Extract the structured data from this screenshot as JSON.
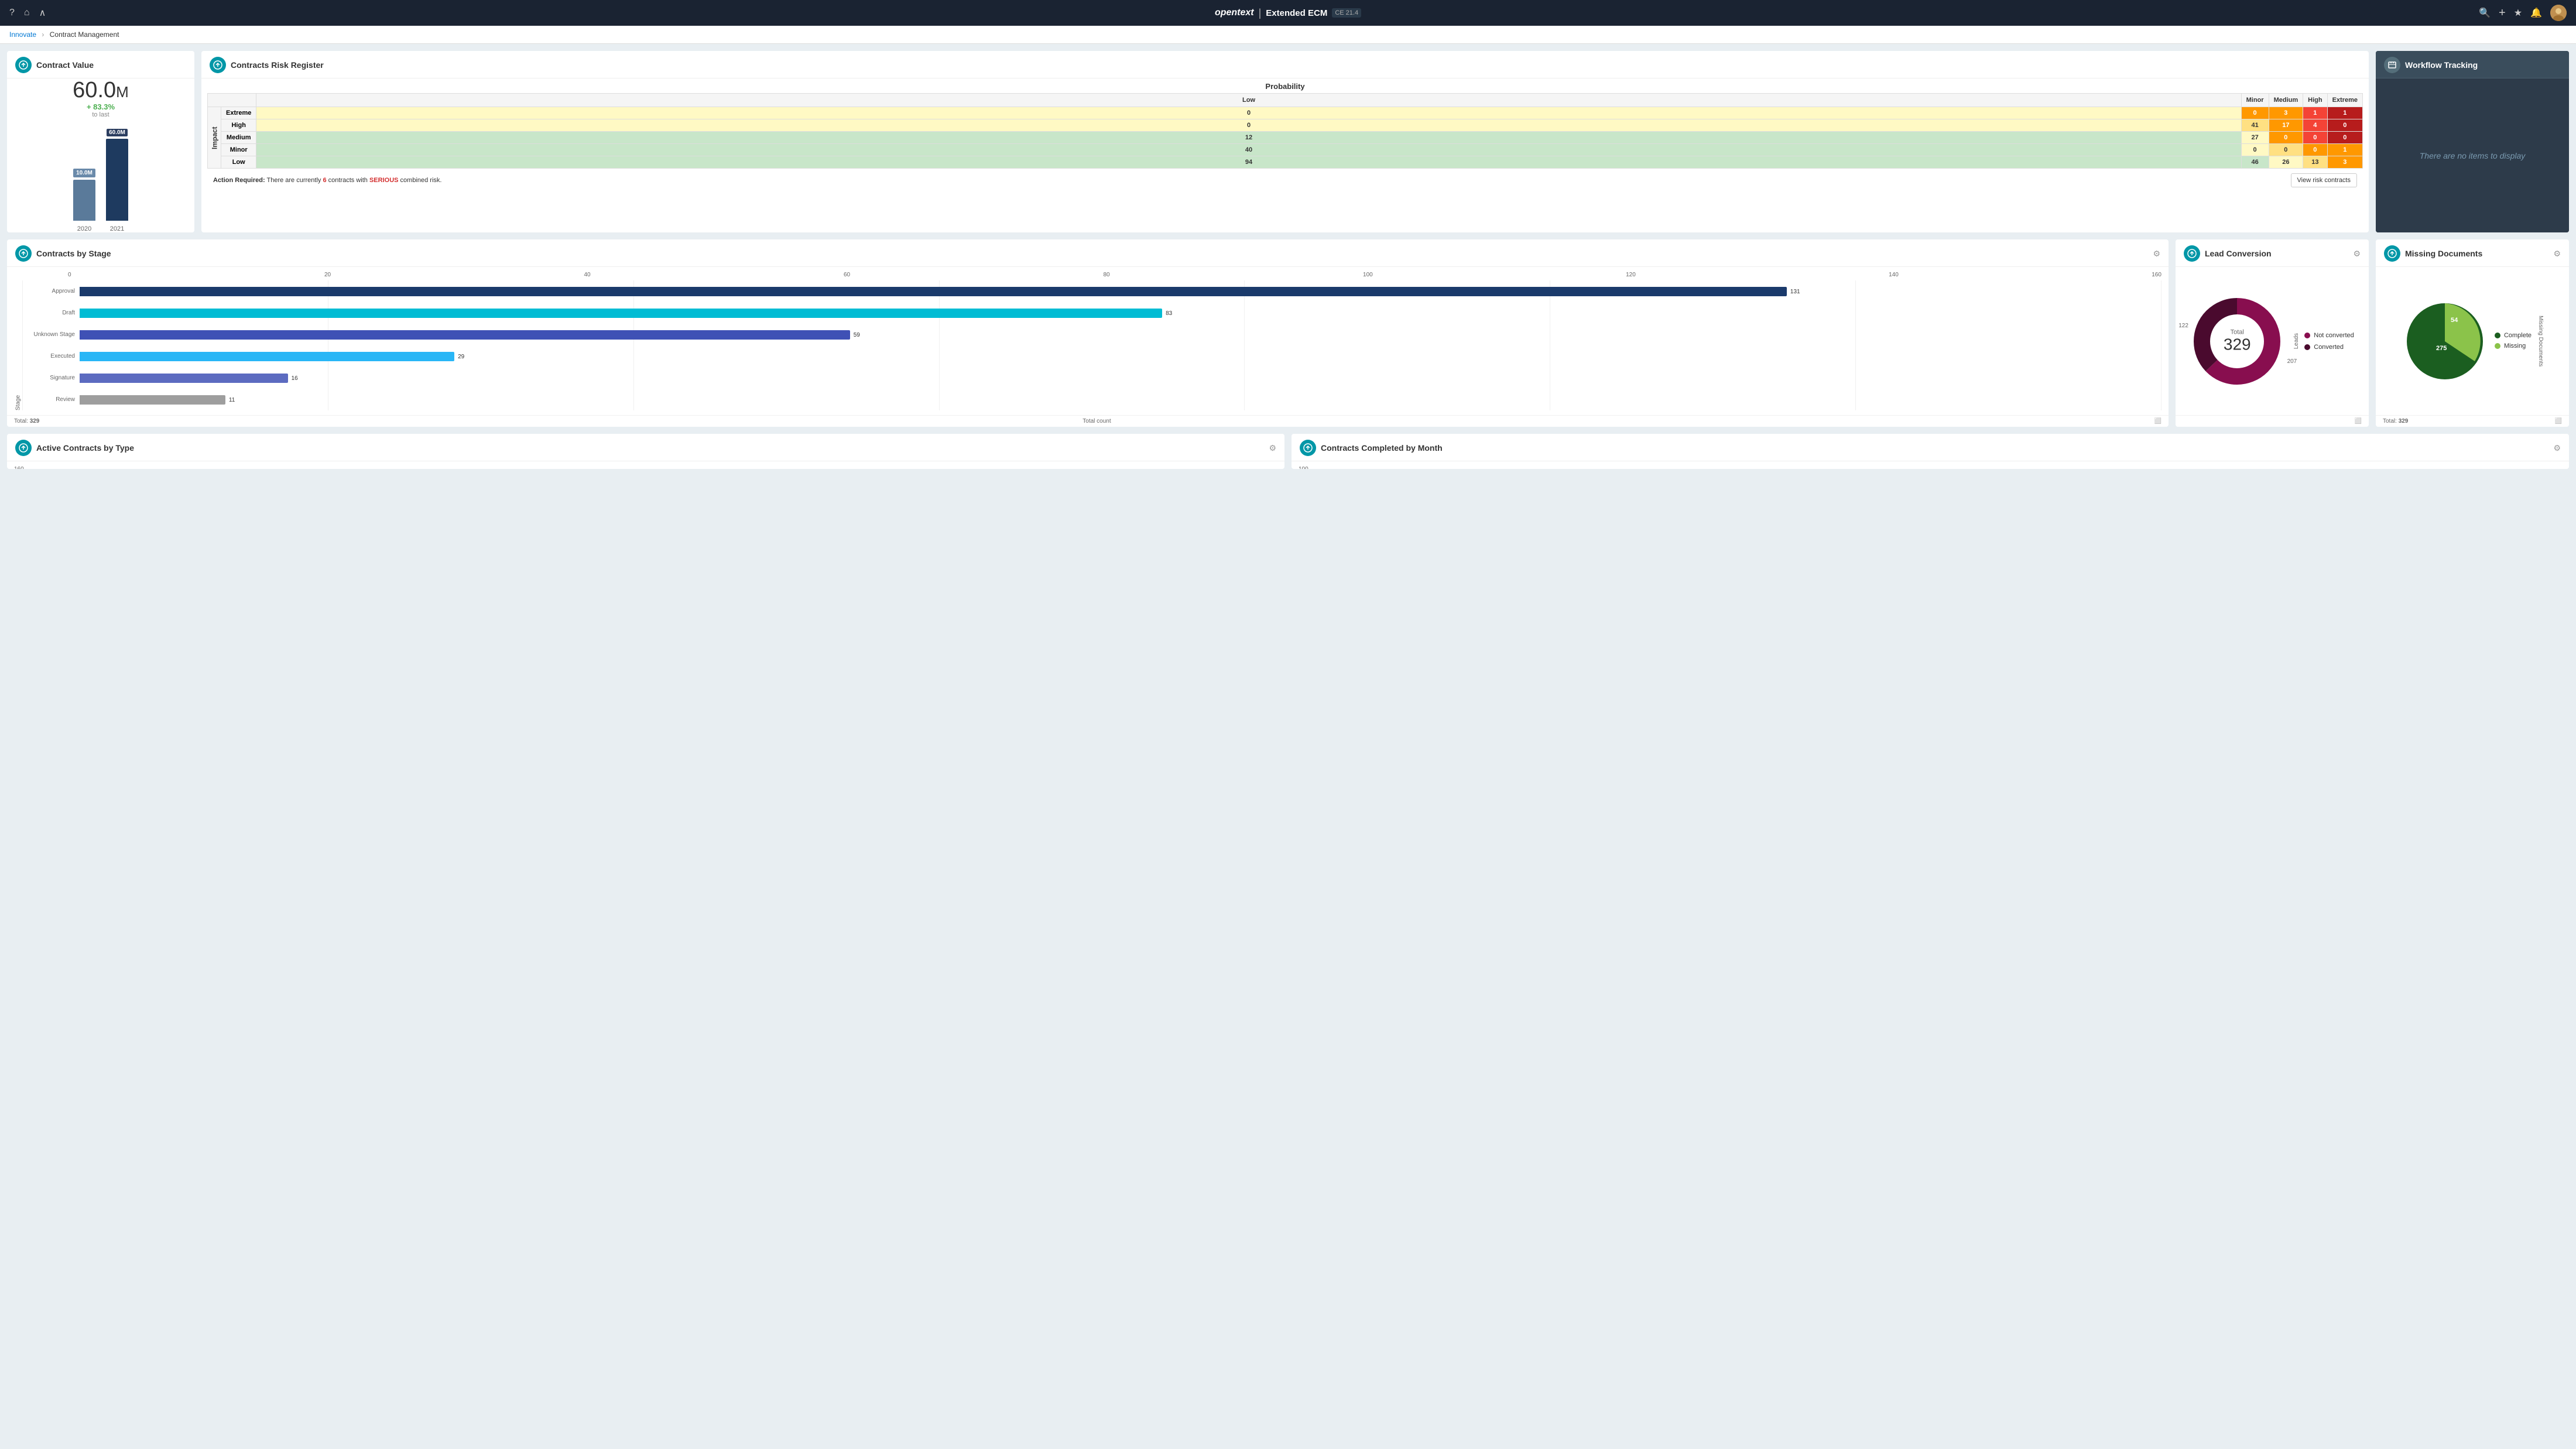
{
  "app": {
    "brand": "opentext",
    "product": "Extended ECM",
    "version": "CE 21.4"
  },
  "nav": {
    "icons": [
      "question-mark",
      "home",
      "chevron-up"
    ],
    "right_icons": [
      "search",
      "plus",
      "star",
      "bell"
    ],
    "breadcrumb_parent": "Innovate",
    "breadcrumb_current": "Contract Management"
  },
  "contract_value": {
    "title": "Contract Value",
    "current_value": "60.0",
    "unit": "M",
    "change_pct": "+ 83.3%",
    "change_label": "to last",
    "bar_2020_label": "10.0M",
    "bar_2020_year": "2020",
    "bar_2021_label": "60.0M",
    "bar_2021_year": "2021"
  },
  "risk_register": {
    "title": "Contracts Risk Register",
    "probability_label": "Probability",
    "impact_label": "Impact",
    "columns": [
      "Low",
      "Minor",
      "Medium",
      "High",
      "Extreme"
    ],
    "rows": [
      {
        "label": "Extreme",
        "values": [
          0,
          0,
          3,
          1,
          1
        ],
        "colors": [
          "yellow",
          "orange",
          "orange",
          "red",
          "dark-red"
        ]
      },
      {
        "label": "High",
        "values": [
          0,
          41,
          17,
          4,
          0
        ],
        "colors": [
          "yellow",
          "light-orange",
          "orange",
          "red",
          "dark-red"
        ]
      },
      {
        "label": "Medium",
        "values": [
          12,
          27,
          0,
          0,
          0
        ],
        "colors": [
          "green",
          "yellow",
          "orange",
          "red",
          "dark-red"
        ]
      },
      {
        "label": "Minor",
        "values": [
          40,
          0,
          0,
          0,
          1
        ],
        "colors": [
          "green",
          "yellow",
          "light-orange",
          "orange",
          "orange"
        ]
      },
      {
        "label": "Low",
        "values": [
          94,
          46,
          26,
          13,
          3
        ],
        "colors": [
          "green",
          "green",
          "yellow",
          "light-orange",
          "orange"
        ]
      }
    ],
    "action_text": "Action Required: There are currently",
    "action_count": "6",
    "action_mid": "contracts with",
    "action_serious": "SERIOUS",
    "action_end": "combined risk.",
    "view_btn": "View risk contracts"
  },
  "workflow": {
    "title": "Workflow Tracking",
    "empty_message": "There are no items to display"
  },
  "contracts_by_stage": {
    "title": "Contracts by Stage",
    "stages": [
      {
        "label": "Approval",
        "value": 131,
        "color": "#1a3a6b",
        "pct": 82
      },
      {
        "label": "Draft",
        "value": 83,
        "color": "#00bcd4",
        "pct": 52
      },
      {
        "label": "Unknown Stage",
        "value": 59,
        "color": "#3f51b5",
        "pct": 37
      },
      {
        "label": "Executed",
        "value": 29,
        "color": "#29b6f6",
        "pct": 18
      },
      {
        "label": "Signature",
        "value": 16,
        "color": "#5c6bc0",
        "pct": 10
      },
      {
        "label": "Review",
        "value": 11,
        "color": "#9e9e9e",
        "pct": 7
      }
    ],
    "axis_labels": [
      "0",
      "20",
      "40",
      "60",
      "80",
      "100",
      "120",
      "140",
      "160"
    ],
    "total_label": "Total:",
    "total_value": "329",
    "count_label": "Total count"
  },
  "lead_conversion": {
    "title": "Lead Conversion",
    "total_label": "Total",
    "total": "329",
    "not_converted": 122,
    "converted": 207,
    "legend": [
      {
        "label": "Not converted",
        "color": "#880e4f"
      },
      {
        "label": "Converted",
        "color": "#6a1540"
      }
    ],
    "y_label": "Leads"
  },
  "missing_documents": {
    "title": "Missing Documents",
    "complete": 275,
    "missing": 54,
    "total_label": "Total:",
    "total": "329",
    "legend": [
      {
        "label": "Complete",
        "color": "#1b5e20"
      },
      {
        "label": "Missing",
        "color": "#8bc34a"
      }
    ],
    "y_label": "Missing Documents"
  },
  "active_contracts": {
    "title": "Active Contracts by Type",
    "y_value": "160"
  },
  "contracts_completed": {
    "title": "Contracts Completed by Month",
    "y_value": "100"
  }
}
